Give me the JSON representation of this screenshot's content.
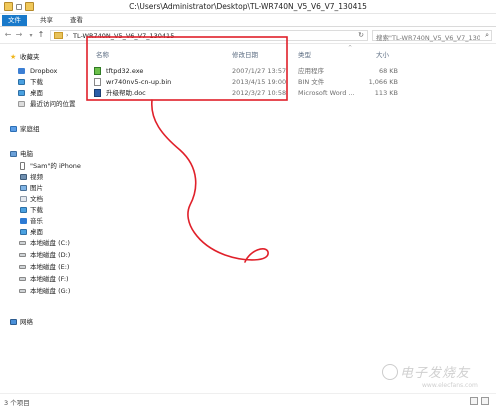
{
  "window": {
    "title": "C:\\Users\\Administrator\\Desktop\\TL-WR740N_V5_V6_V7_130415"
  },
  "ribbon": {
    "tabs": [
      "文件",
      "共享",
      "查看"
    ]
  },
  "address": {
    "path": "TL-WR740N_V5_V6_V7_130415",
    "search_placeholder": "搜索\"TL-WR740N_V5_V6_V7_130415\""
  },
  "sidebar": {
    "favorites": "收藏夹",
    "items_fav": [
      "Dropbox",
      "下载",
      "桌面",
      "最近访问的位置"
    ],
    "homegroup": "家庭组",
    "computer": "电脑",
    "items_pc": [
      "\"Sam\"的 iPhone",
      "视频",
      "图片",
      "文档",
      "下载",
      "音乐",
      "桌面",
      "本地磁盘 (C:)",
      "本地磁盘 (D:)",
      "本地磁盘 (E:)",
      "本地磁盘 (F:)",
      "本地磁盘 (G:)"
    ],
    "network": "网络"
  },
  "columns": {
    "name": "名称",
    "date": "修改日期",
    "type": "类型",
    "size": "大小"
  },
  "files": [
    {
      "name": "tftpd32.exe",
      "date": "2007/1/27 13:57",
      "type": "应用程序",
      "size": "68 KB",
      "icon": "exe-icon"
    },
    {
      "name": "wr740nv5-cn-up.bin",
      "date": "2013/4/15 19:00",
      "type": "BIN 文件",
      "size": "1,066 KB",
      "icon": "bin-file-icon"
    },
    {
      "name": "升级帮助.doc",
      "date": "2012/3/27 10:58",
      "type": "Microsoft Word ...",
      "size": "113 KB",
      "icon": "word-doc-icon"
    }
  ],
  "status": {
    "count": "3 个项目"
  },
  "watermark": {
    "text": "电子发烧友",
    "url": "www.elecfans.com"
  },
  "colors": {
    "file_tab": "#1979ca",
    "annotation": "#e0202a"
  }
}
